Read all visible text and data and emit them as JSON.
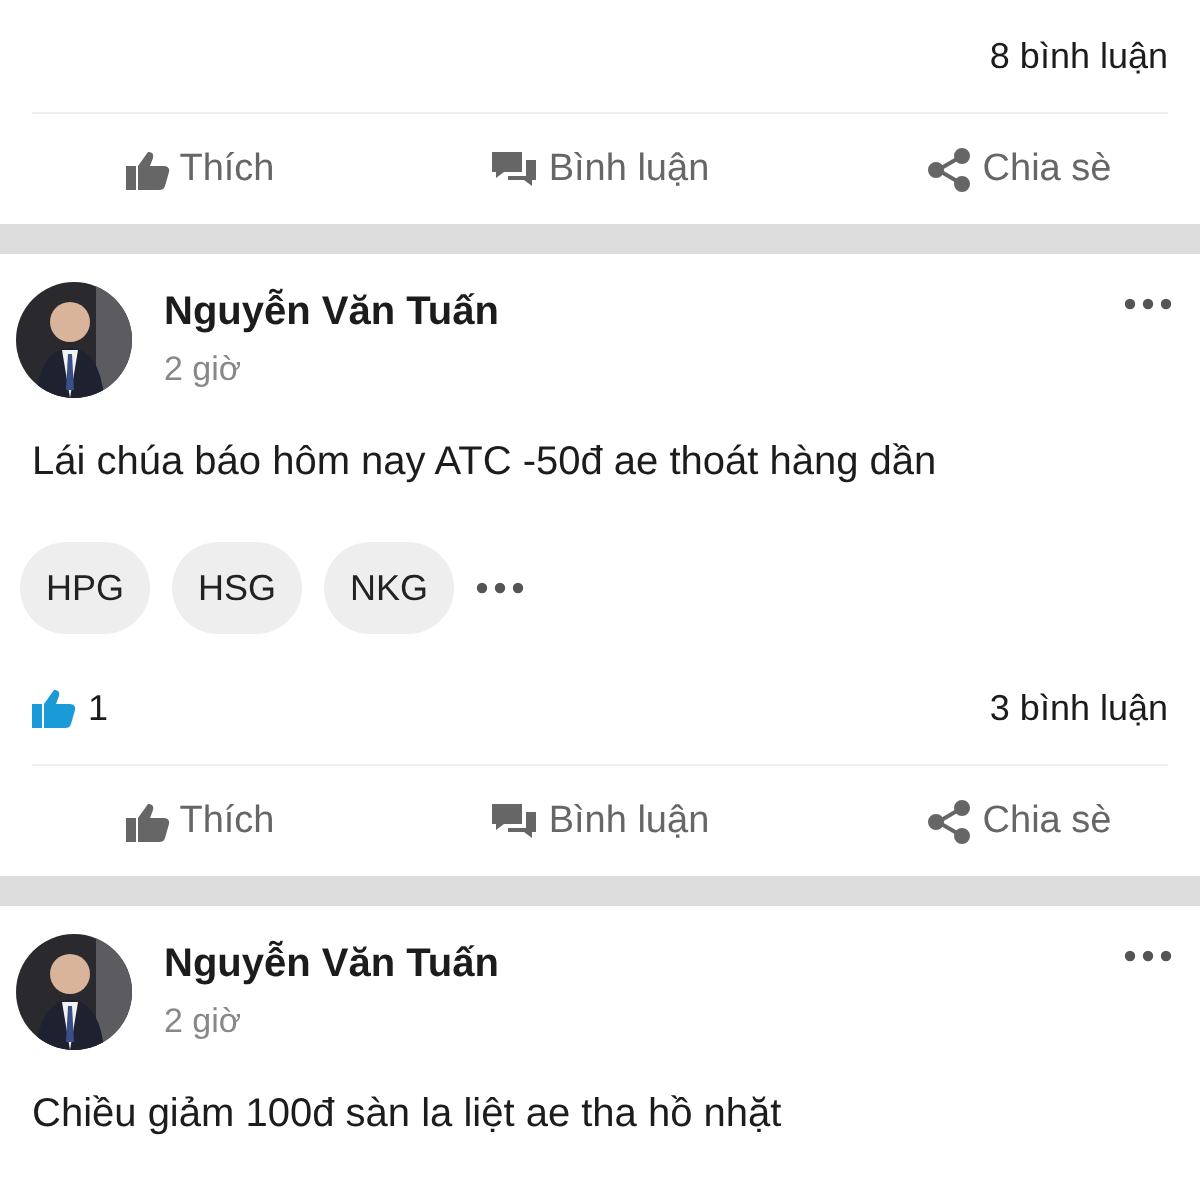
{
  "posts": [
    {
      "comments": "8 bình luận",
      "actions": [
        {
          "kind": "like",
          "label": "Thích"
        },
        {
          "kind": "comment",
          "label": "Bình luận"
        },
        {
          "kind": "share",
          "label": "Chia sè"
        }
      ]
    },
    {
      "author": {
        "name": "Nguyễn Văn Tuấn",
        "time": "2 giờ"
      },
      "text": "Lái chúa báo hôm nay ATC -50đ ae thoát hàng dần",
      "tags": [
        "HPG",
        "HSG",
        "NKG"
      ],
      "likes": "1",
      "comments": "3 bình luận",
      "actions": [
        {
          "kind": "like",
          "label": "Thích"
        },
        {
          "kind": "comment",
          "label": "Bình luận"
        },
        {
          "kind": "share",
          "label": "Chia sè"
        }
      ]
    },
    {
      "author": {
        "name": "Nguyễn Văn Tuấn",
        "time": "2 giờ"
      },
      "text": "Chiều giảm 100đ sàn la liệt ae tha hồ nhặt"
    }
  ]
}
